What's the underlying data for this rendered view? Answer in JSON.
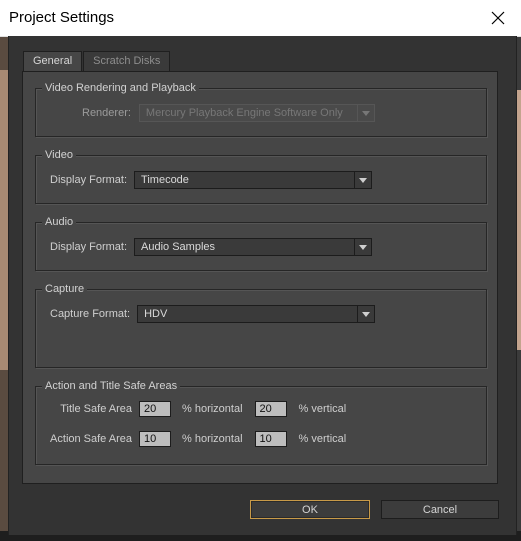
{
  "window": {
    "title": "Project Settings"
  },
  "tabs": [
    {
      "label": "General",
      "active": true
    },
    {
      "label": "Scratch Disks",
      "active": false
    }
  ],
  "video_rendering": {
    "legend": "Video Rendering and Playback",
    "renderer_label": "Renderer:",
    "renderer_value": "Mercury Playback Engine Software Only"
  },
  "video": {
    "legend": "Video",
    "display_format_label": "Display Format:",
    "display_format_value": "Timecode"
  },
  "audio": {
    "legend": "Audio",
    "display_format_label": "Display Format:",
    "display_format_value": "Audio Samples"
  },
  "capture": {
    "legend": "Capture",
    "capture_format_label": "Capture Format:",
    "capture_format_value": "HDV"
  },
  "safe_areas": {
    "legend": "Action and Title Safe Areas",
    "title_label": "Title Safe Area",
    "title_horizontal": "20",
    "title_vertical": "20",
    "action_label": "Action Safe Area",
    "action_horizontal": "10",
    "action_vertical": "10",
    "horizontal_unit": "% horizontal",
    "vertical_unit": "% vertical"
  },
  "buttons": {
    "ok": "OK",
    "cancel": "Cancel"
  },
  "colors": {
    "panel": "#464646",
    "ok_focus": "#c89a48"
  }
}
